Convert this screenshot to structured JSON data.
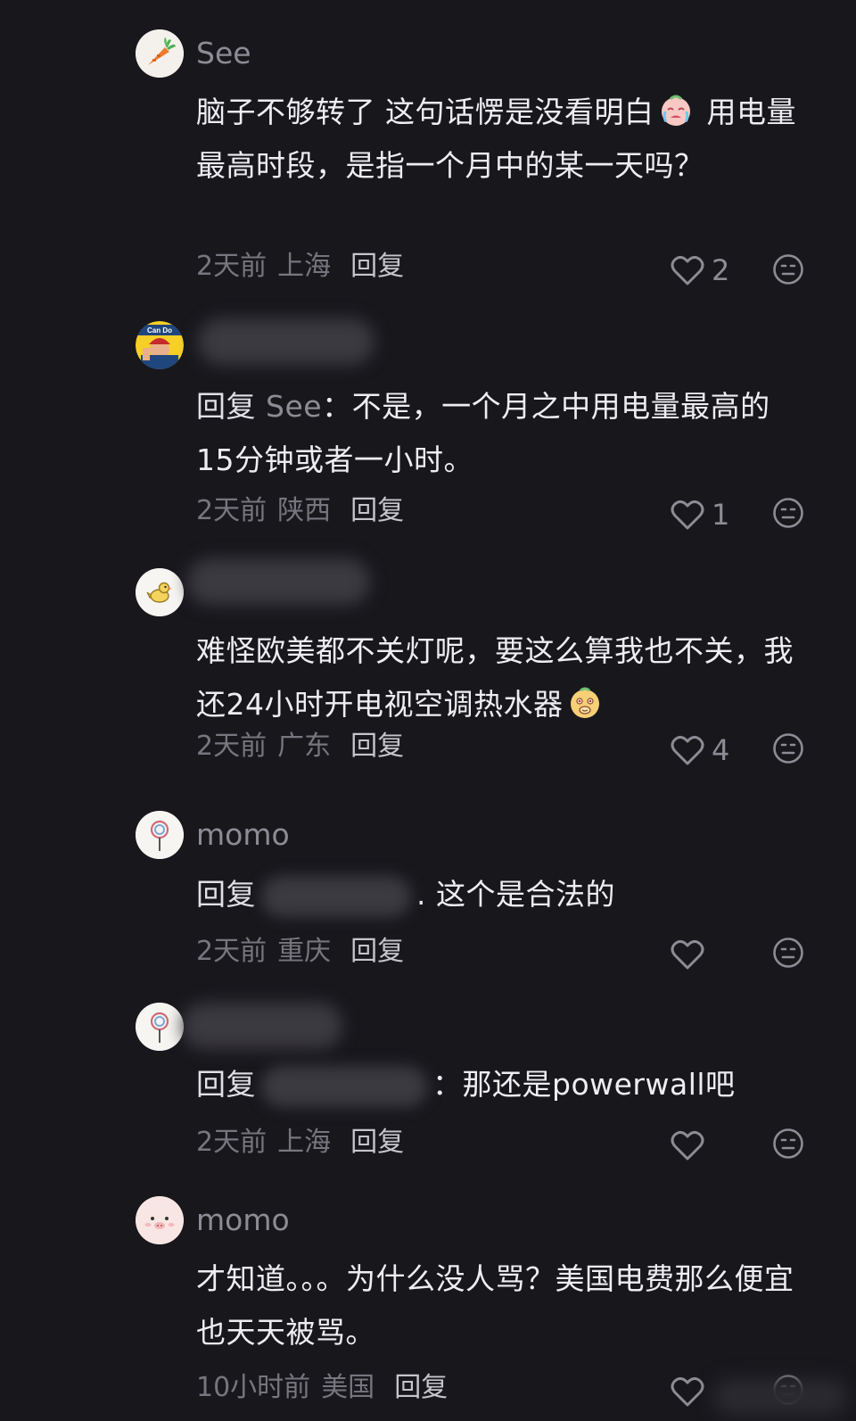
{
  "comments": [
    {
      "username": "See",
      "text_a": "脑子不够转了 这句话愣是没看明白",
      "text_b": " 用电量最高时段，是指一个月中的某一天吗？",
      "time": "2天前",
      "location": "上海",
      "reply_label": "回复",
      "likes": "2"
    },
    {
      "reply_prefix": "回复",
      "reply_target": "See",
      "text": "：不是，一个月之中用电量最高的15分钟或者一小时。",
      "time": "2天前",
      "location": "陕西",
      "reply_label": "回复",
      "likes": "1"
    },
    {
      "text_a": "难怪欧美都不关灯呢，要这么算我也不关，我还24小时开电视空调热水器",
      "time": "2天前",
      "location": "广东",
      "reply_label": "回复",
      "likes": "4"
    },
    {
      "username": "momo",
      "reply_prefix": "回复",
      "text": ". 这个是合法的",
      "time": "2天前",
      "location": "重庆",
      "reply_label": "回复",
      "likes": ""
    },
    {
      "reply_prefix": "回复",
      "text": "：那还是powerwall吧",
      "time": "2天前",
      "location": "上海",
      "reply_label": "回复",
      "likes": ""
    },
    {
      "username": "momo",
      "text": "才知道。。。为什么没人骂？美国电费那么便宜也天天被骂。",
      "time": "10小时前",
      "location": "美国",
      "reply_label": "回复",
      "likes": ""
    }
  ],
  "avatar_badge_text": "Can Do",
  "colors": {
    "background": "#18171c",
    "text_primary": "#ededf2",
    "text_muted": "#8d8c94",
    "meta": "#77767e"
  },
  "icons": [
    "heart-icon",
    "emoji-icon",
    "crying-face-emoji",
    "smirk-face-emoji"
  ]
}
